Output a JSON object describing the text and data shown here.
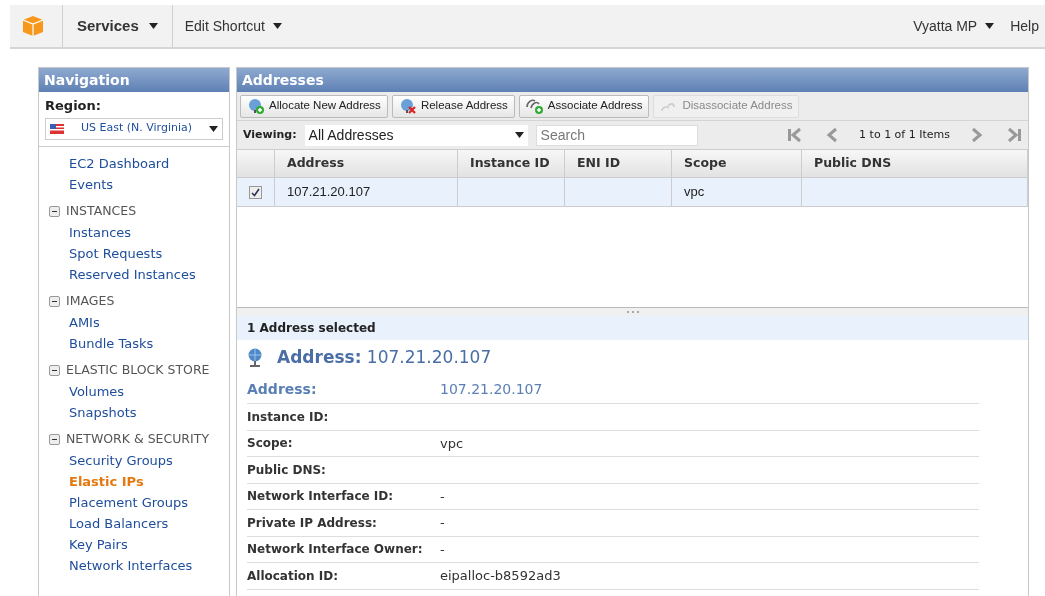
{
  "top_bar": {
    "services": "Services",
    "edit_shortcut": "Edit Shortcut",
    "account": "Vyatta MP",
    "help": "Help"
  },
  "navigation": {
    "title": "Navigation",
    "region_label": "Region:",
    "region": "US East (N. Virginia)",
    "groups": [
      {
        "items": [
          {
            "label": "EC2 Dashboard",
            "selected": false
          },
          {
            "label": "Events",
            "selected": false
          }
        ]
      },
      {
        "label": "INSTANCES",
        "expanded": true,
        "items": [
          {
            "label": "Instances",
            "selected": false
          },
          {
            "label": "Spot Requests",
            "selected": false
          },
          {
            "label": "Reserved Instances",
            "selected": false
          }
        ]
      },
      {
        "label": "IMAGES",
        "expanded": true,
        "items": [
          {
            "label": "AMIs",
            "selected": false
          },
          {
            "label": "Bundle Tasks",
            "selected": false
          }
        ]
      },
      {
        "label": "ELASTIC BLOCK STORE",
        "expanded": true,
        "items": [
          {
            "label": "Volumes",
            "selected": false
          },
          {
            "label": "Snapshots",
            "selected": false
          }
        ]
      },
      {
        "label": "NETWORK & SECURITY",
        "expanded": true,
        "items": [
          {
            "label": "Security Groups",
            "selected": false
          },
          {
            "label": "Elastic IPs",
            "selected": true
          },
          {
            "label": "Placement Groups",
            "selected": false
          },
          {
            "label": "Load Balancers",
            "selected": false
          },
          {
            "label": "Key Pairs",
            "selected": false
          },
          {
            "label": "Network Interfaces",
            "selected": false
          }
        ]
      }
    ]
  },
  "addresses": {
    "title": "Addresses",
    "toolbar": [
      {
        "label": "Allocate New Address",
        "kind": "add",
        "disabled": false
      },
      {
        "label": "Release Address",
        "kind": "remove",
        "disabled": false
      },
      {
        "label": "Associate Address",
        "kind": "link",
        "disabled": false
      },
      {
        "label": "Disassociate Address",
        "kind": "unlink",
        "disabled": true
      }
    ],
    "viewing_label": "Viewing:",
    "viewing": "All Addresses",
    "search": {
      "placeholder": "Search"
    },
    "pager": "1 to 1 of 1 Items",
    "table": {
      "columns": [
        "Address",
        "Instance ID",
        "ENI ID",
        "Scope",
        "Public DNS"
      ],
      "rows": [
        {
          "checked": true,
          "selected": true,
          "cells": [
            "107.21.20.107",
            "",
            "",
            "vpc",
            ""
          ]
        }
      ]
    },
    "details": {
      "summary": "1 Address selected",
      "heading_label": "Address:",
      "heading_value": "107.21.20.107",
      "rows": [
        {
          "kind": "primary",
          "label": "Address:",
          "value": "107.21.20.107"
        },
        {
          "kind": "plain",
          "label": "Instance ID:",
          "value": null
        },
        {
          "kind": "plain",
          "label": "Scope:",
          "value": "vpc"
        },
        {
          "kind": "plain",
          "label": "Public DNS:",
          "value": null
        },
        {
          "kind": "plain",
          "label": "Network Interface ID:",
          "value": "-"
        },
        {
          "kind": "plain",
          "label": "Private IP Address:",
          "value": "-"
        },
        {
          "kind": "plain",
          "label": "Network Interface Owner:",
          "value": "-"
        },
        {
          "kind": "plain",
          "label": "Allocation ID:",
          "value": "eipalloc-b8592ad3"
        }
      ]
    }
  }
}
